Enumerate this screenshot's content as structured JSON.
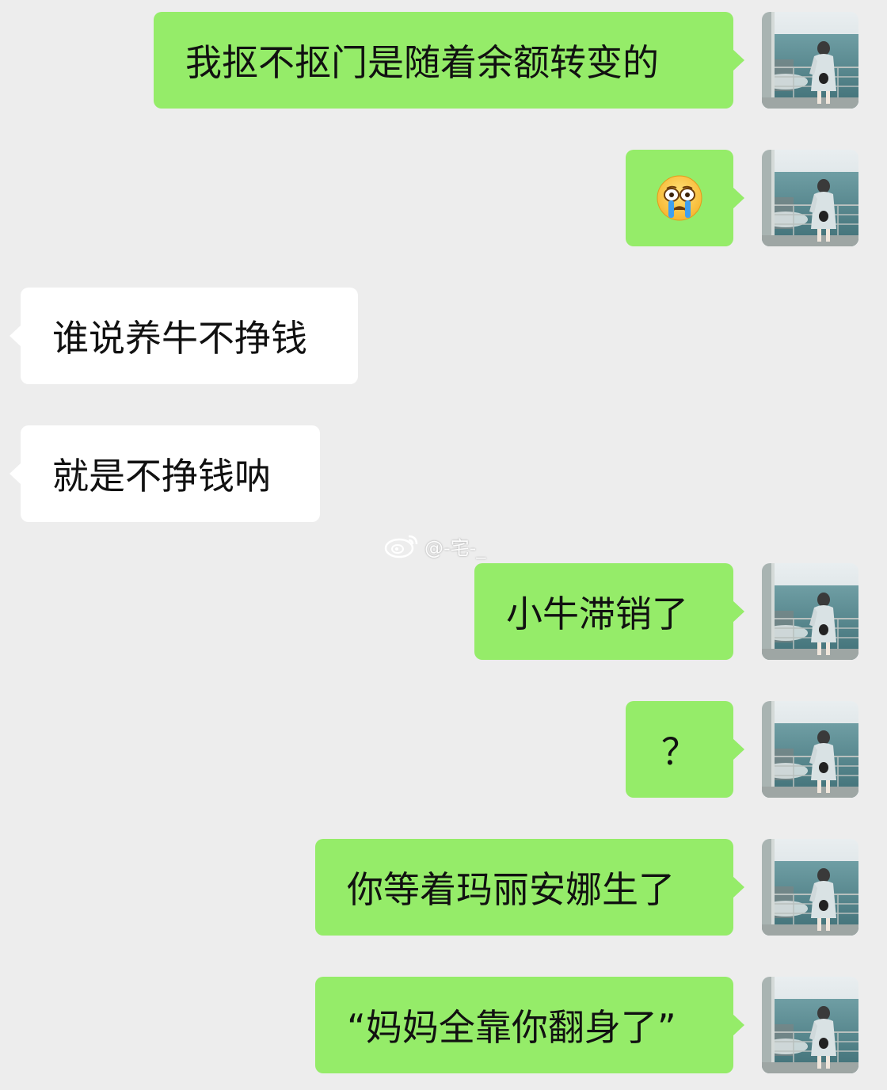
{
  "messages": [
    {
      "side": "out",
      "text": "我抠不抠门是随着余额转变的"
    },
    {
      "side": "out",
      "emoji": "crying-face-emoji"
    },
    {
      "side": "in",
      "text": "谁说养牛不挣钱"
    },
    {
      "side": "in",
      "text": "就是不挣钱呐"
    },
    {
      "side": "out",
      "text": "小牛滞销了"
    },
    {
      "side": "out",
      "text": "？"
    },
    {
      "side": "out",
      "text": "你等着玛丽安娜生了"
    },
    {
      "side": "out",
      "text": "“妈妈全靠你翻身了”"
    }
  ],
  "watermark": {
    "icon": "weibo-icon",
    "text": "@-宅-_"
  },
  "colors": {
    "background": "#ededed",
    "outgoing_bubble": "#95ec69",
    "incoming_bubble": "#ffffff"
  }
}
